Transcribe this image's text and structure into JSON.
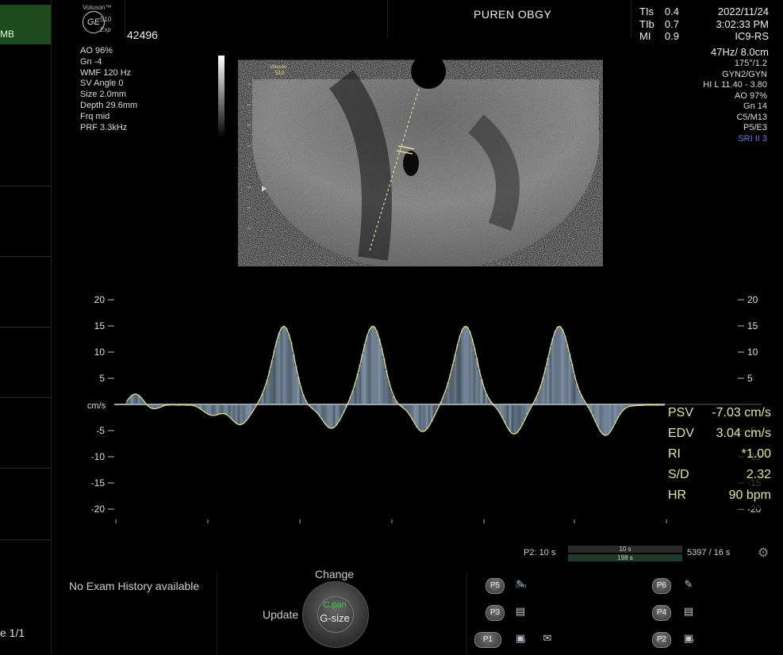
{
  "left_panel": {
    "tab_text": "MB",
    "page_indicator": "e 1/1"
  },
  "header": {
    "brand_line1": "Voluson™",
    "logo_text": "GE",
    "brand_line2": "S10",
    "brand_line3": "Exp",
    "patient_id": "42496",
    "institution": "PUREN OBGY"
  },
  "safety": [
    {
      "label": "TIs",
      "value": "0.4"
    },
    {
      "label": "TIb",
      "value": "0.7"
    },
    {
      "label": "MI",
      "value": "0.9"
    }
  ],
  "datetime": {
    "date": "2022/11/24",
    "time": "3:02:33 PM",
    "probe": "IC9-RS"
  },
  "freq_depth": "47Hz/ 8.0cm",
  "right_params": [
    "175°/1.2",
    "GYN2/GYN",
    "HI L  11.40 - 3.80",
    "AO 97%",
    "Gn  14",
    "C5/M13",
    "P5/E3"
  ],
  "right_params_highlight": "SRI II 3",
  "left_params": [
    "AO 96%",
    "Gn  -4",
    "WMF 120 Hz",
    "SV Angle  0",
    "Size  2.0mm",
    "Depth 29.6mm",
    "Frq mid",
    "PRF  3.3kHz"
  ],
  "bmode": {
    "label_line1": "Voluson",
    "label_line2": "S10"
  },
  "doppler": {
    "y_ticks": [
      20,
      15,
      10,
      5,
      -5,
      -10,
      -15,
      -20
    ],
    "unit": "cm/s"
  },
  "measurements": [
    {
      "label": "PSV",
      "value": "-7.03 cm/s"
    },
    {
      "label": "EDV",
      "value": "3.04 cm/s"
    },
    {
      "label": "RI",
      "value": "*1.00"
    },
    {
      "label": "S/D",
      "value": "2.32"
    },
    {
      "label": "HR",
      "value": "90 bpm"
    }
  ],
  "timeline": {
    "label": "P2:  10 s",
    "top": "10 s",
    "bottom": "198 s",
    "frames": "5397 / 16 s"
  },
  "bottom": {
    "exam_history": "No Exam History available",
    "change": "Change",
    "update": "Update",
    "trackball_top": "C.pan",
    "trackball_main": "G-size"
  },
  "pbuttons": [
    "P5",
    "P3",
    "P1",
    "P6",
    "P4",
    "P2"
  ],
  "picons": {
    "gyn": "GYN",
    "img": "Img",
    "cine": "Cine"
  }
}
